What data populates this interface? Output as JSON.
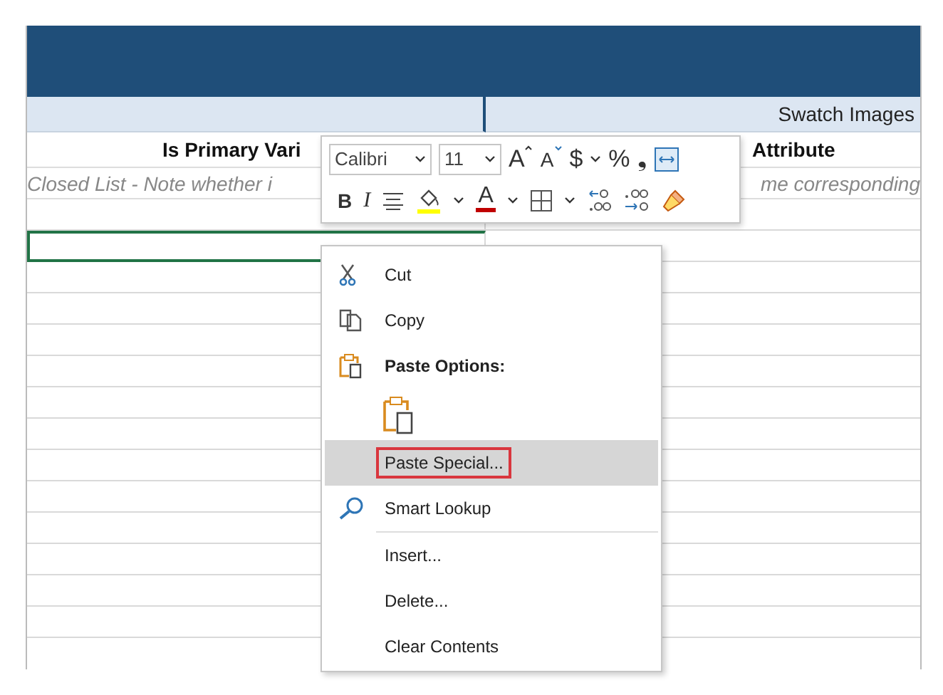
{
  "sheet": {
    "band_label": "Swatch Images",
    "headers": [
      "Is Primary Vari",
      "Attribute"
    ],
    "descriptions": [
      "Closed List - Note whether i",
      "me corresponding"
    ]
  },
  "mini_toolbar": {
    "font": "Calibri",
    "size": "11",
    "row1": [
      {
        "kind": "grow",
        "text": "A"
      },
      {
        "kind": "shrink",
        "text": "A"
      },
      {
        "kind": "text",
        "text": "$"
      },
      {
        "kind": "caret"
      },
      {
        "kind": "text",
        "text": "%"
      },
      {
        "kind": "text",
        "text": "❟"
      },
      {
        "kind": "merge"
      }
    ],
    "row2": [
      {
        "kind": "bold",
        "text": "B"
      },
      {
        "kind": "italic",
        "text": "I"
      },
      {
        "kind": "align"
      },
      {
        "kind": "fill"
      },
      {
        "kind": "caret"
      },
      {
        "kind": "fontcolor",
        "text": "A"
      },
      {
        "kind": "caret"
      },
      {
        "kind": "borders"
      },
      {
        "kind": "caret"
      },
      {
        "kind": "decdec"
      },
      {
        "kind": "incdec"
      },
      {
        "kind": "painter"
      }
    ]
  },
  "context_menu": [
    {
      "kind": "cut",
      "label": "Cut",
      "selected": false
    },
    {
      "kind": "copy",
      "label": "Copy",
      "selected": false
    },
    {
      "kind": "header",
      "label": "Paste Options:"
    },
    {
      "kind": "paste-option"
    },
    {
      "kind": "item",
      "label": "Paste Special...",
      "selected": true
    },
    {
      "kind": "lookup",
      "label": "Smart Lookup",
      "selected": false
    },
    {
      "kind": "separator"
    },
    {
      "kind": "item",
      "label": "Insert...",
      "selected": false
    },
    {
      "kind": "item",
      "label": "Delete...",
      "selected": false
    },
    {
      "kind": "item",
      "label": "Clear Contents",
      "selected": false
    }
  ]
}
